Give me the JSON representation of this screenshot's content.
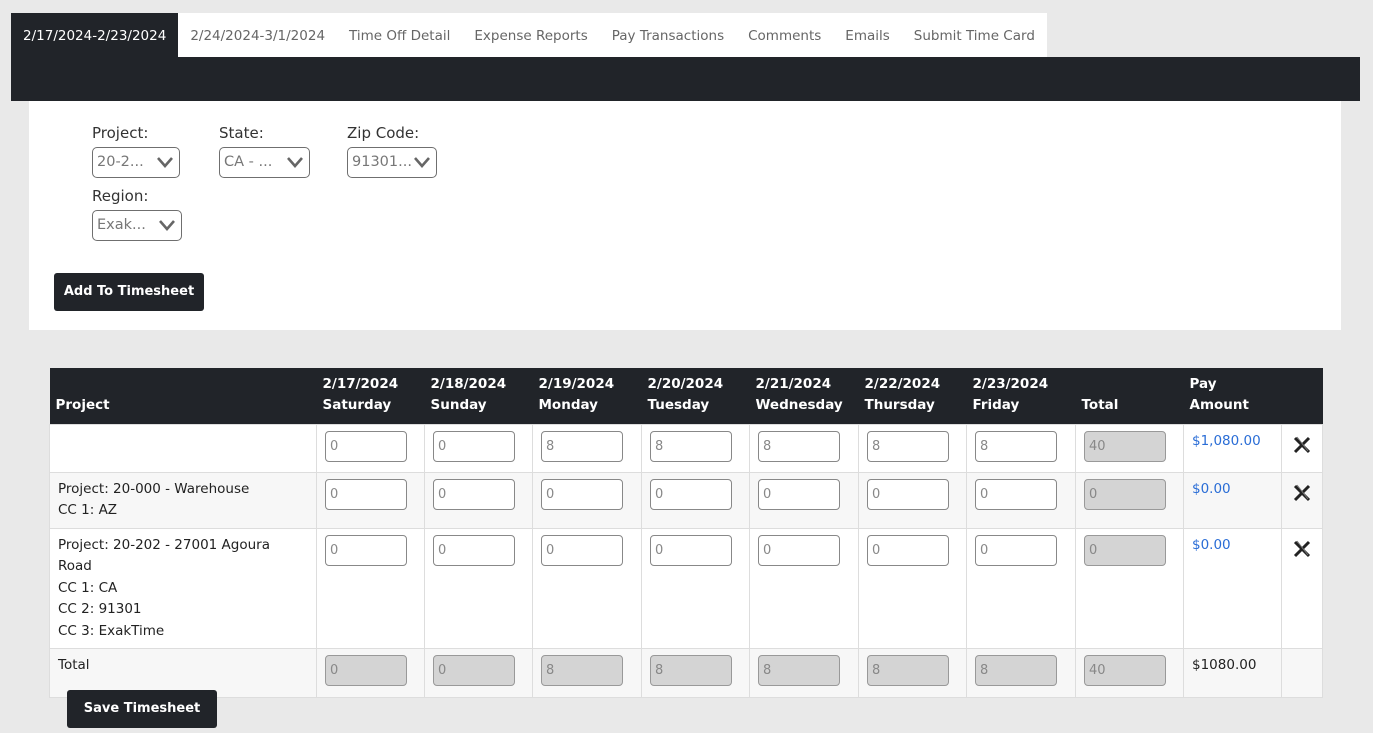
{
  "tabs": [
    {
      "label": "2/17/2024-2/23/2024",
      "active": true
    },
    {
      "label": "2/24/2024-3/1/2024",
      "active": false
    },
    {
      "label": "Time Off Detail",
      "active": false
    },
    {
      "label": "Expense Reports",
      "active": false
    },
    {
      "label": "Pay Transactions",
      "active": false
    },
    {
      "label": "Comments",
      "active": false
    },
    {
      "label": "Emails",
      "active": false
    },
    {
      "label": "Submit Time Card",
      "active": false
    }
  ],
  "filters": {
    "project": {
      "label": "Project:",
      "value": "20-2..."
    },
    "state": {
      "label": "State:",
      "value": "CA - ..."
    },
    "zip": {
      "label": "Zip Code:",
      "value": "91301..."
    },
    "region": {
      "label": "Region:",
      "value": "Exak..."
    }
  },
  "add_button": "Add To Timesheet",
  "table": {
    "headers": {
      "project": "Project",
      "days": [
        {
          "date": "2/17/2024",
          "day": "Saturday"
        },
        {
          "date": "2/18/2024",
          "day": "Sunday"
        },
        {
          "date": "2/19/2024",
          "day": "Monday"
        },
        {
          "date": "2/20/2024",
          "day": "Tuesday"
        },
        {
          "date": "2/21/2024",
          "day": "Wednesday"
        },
        {
          "date": "2/22/2024",
          "day": "Thursday"
        },
        {
          "date": "2/23/2024",
          "day": "Friday"
        }
      ],
      "total": "Total",
      "pay": "Pay Amount"
    },
    "rows": [
      {
        "lines": [],
        "hours": [
          "0",
          "0",
          "8",
          "8",
          "8",
          "8",
          "8"
        ],
        "total": "40",
        "pay": "$1,080.00"
      },
      {
        "lines": [
          "Project: 20-000 - Warehouse",
          "CC 1: AZ"
        ],
        "hours": [
          "0",
          "0",
          "0",
          "0",
          "0",
          "0",
          "0"
        ],
        "total": "0",
        "pay": "$0.00"
      },
      {
        "lines": [
          "Project: 20-202 - 27001 Agoura Road",
          "CC 1: CA",
          "CC 2: 91301",
          "CC 3: ExakTime"
        ],
        "hours": [
          "0",
          "0",
          "0",
          "0",
          "0",
          "0",
          "0"
        ],
        "total": "0",
        "pay": "$0.00"
      }
    ],
    "totals_row": {
      "label": "Total",
      "hours": [
        "0",
        "0",
        "8",
        "8",
        "8",
        "8",
        "8"
      ],
      "total": "40",
      "pay": "$1080.00"
    }
  },
  "save_button": "Save Timesheet",
  "colors": {
    "dark": "#212429",
    "link": "#2a6dd6",
    "background": "#e9e9e9"
  }
}
